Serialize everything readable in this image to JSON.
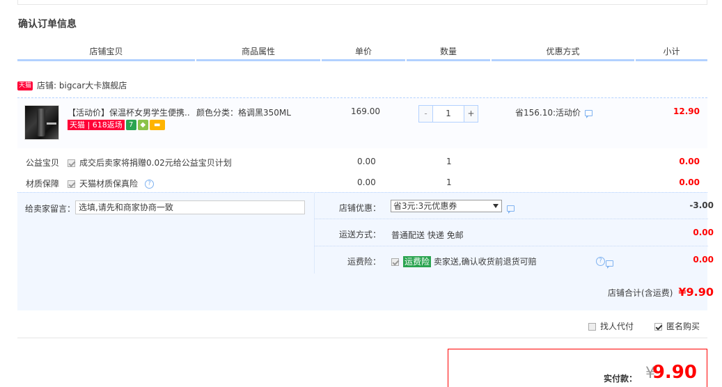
{
  "section_title": "确认订单信息",
  "columns": [
    "店铺宝贝",
    "商品属性",
    "单价",
    "数量",
    "优惠方式",
    "小计"
  ],
  "store": {
    "badge": "天猫",
    "label": "店铺: bigcar大卡旗舰店"
  },
  "item": {
    "title": "【活动价】保温杯女男学生便携...",
    "badge_618": "天猫 | 618返场",
    "attr": "颜色分类：格调黑350ML",
    "price": "169.00",
    "qty_minus": "-",
    "qty": "1",
    "qty_plus": "+",
    "promo": "省156.10:活动价",
    "subtotal": "12.90"
  },
  "services": [
    {
      "label": "公益宝贝",
      "desc": "成交后卖家将捐赠0.02元给公益宝贝计划",
      "price": "0.00",
      "qty": "1",
      "subtotal": "0.00"
    },
    {
      "label": "材质保障",
      "desc": "天猫材质保真险",
      "price": "0.00",
      "qty": "1",
      "subtotal": "0.00"
    }
  ],
  "message": {
    "label": "给卖家留言：",
    "placeholder": "选填,请先和商家协商一致"
  },
  "store_discount": {
    "label": "店铺优惠：",
    "selected": "省3元:3元优惠券",
    "value": "-3.00"
  },
  "shipping": {
    "label": "运送方式：",
    "value": "普通配送 快递 免邮",
    "amount": "0.00"
  },
  "insurance": {
    "label": "运费险：",
    "tag": "运费险",
    "desc": "卖家送,确认收货前退货可赔",
    "amount": "0.00"
  },
  "store_total": {
    "label": "店铺合计(含运费)",
    "value": "¥9.90"
  },
  "options": {
    "proxy": "找人代付",
    "anonymous": "匿名购买"
  },
  "payment": {
    "label": "实付款：",
    "currency": "¥",
    "amount": "9.90"
  },
  "colors": {
    "accent_red": "#ff0000",
    "tmall_red": "#ff0036",
    "header_line": "#b2d1ff",
    "panel_bg": "#f2f7ff",
    "green_tag": "#2aa450"
  }
}
